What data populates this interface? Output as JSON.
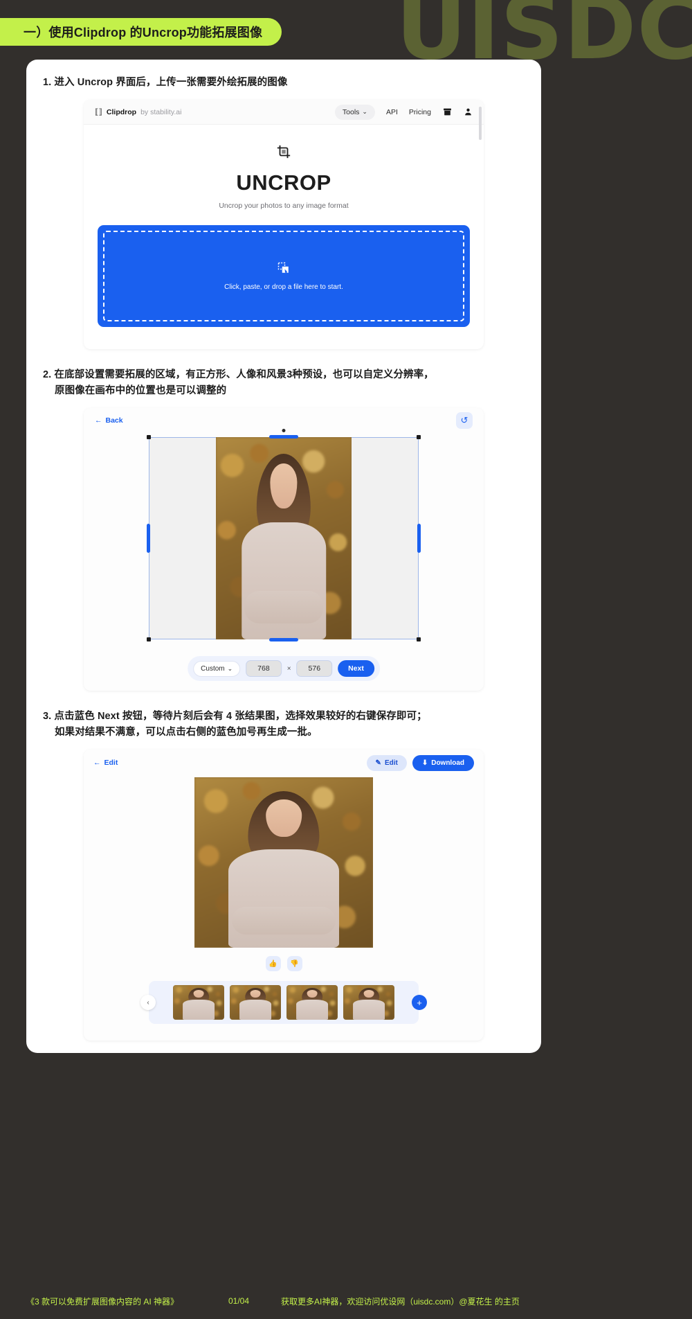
{
  "watermark": "UISDC",
  "title_pill": {
    "label": "一）使用Clipdrop 的Uncrop功能拓展图像"
  },
  "steps": {
    "step1": "1. 进入 Uncrop 界面后，上传一张需要外绘拓展的图像",
    "step2_line1": "2. 在底部设置需要拓展的区域，有正方形、人像和风景3种预设，也可以自定义分辨率，",
    "step2_line2": "原图像在画布中的位置也是可以调整的",
    "step3_line1": "3. 点击蓝色 Next 按钮，等待片刻后会有 4 张结果图，选择效果较好的右键保存即可；",
    "step3_line2": "如果对结果不满意，可以点击右侧的蓝色加号再生成一批。"
  },
  "panel1": {
    "nav": {
      "brand": "Clipdrop",
      "by": "by stability.ai",
      "tools": "Tools",
      "api": "API",
      "pricing": "Pricing",
      "chevron": "⌄",
      "archive_icon": "▤",
      "account_icon": "●"
    },
    "hero": {
      "icon": "⛶",
      "title": "UNCROP",
      "subtitle": "Uncrop your photos to any image format"
    },
    "dropzone": {
      "icon": "⬚",
      "label": "Click, paste, or drop a file here to start."
    }
  },
  "panel2": {
    "back": "Back",
    "back_arrow": "←",
    "undo_icon": "↺",
    "preset": "Custom",
    "preset_chevron": "⌄",
    "width": "768",
    "height": "576",
    "times": "×",
    "next": "Next"
  },
  "panel3": {
    "back": "Edit",
    "back_arrow": "←",
    "edit": "Edit",
    "edit_icon": "✎",
    "download": "Download",
    "download_icon": "⬇",
    "thumbs_up": "👍",
    "thumbs_down": "👎",
    "prev_arrow": "‹",
    "add": "+",
    "thumb_count": 4
  },
  "footer": {
    "title": "《3 款可以免费扩展图像内容的 AI 神器》",
    "page": "01/04",
    "note": "获取更多AI神器，欢迎访问优设网（uisdc.com）@夏花生 的主页"
  },
  "colors": {
    "bg": "#322f2c",
    "accent_green": "#c3f04a",
    "watermark": "#5b6233",
    "blue": "#1a60ef",
    "light_blue": "#e5ecfd"
  }
}
